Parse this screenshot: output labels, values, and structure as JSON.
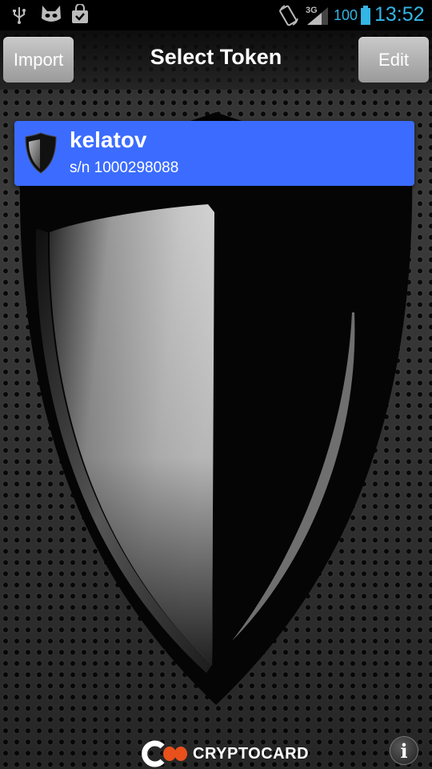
{
  "status_bar": {
    "battery_percent": "100",
    "network_type": "3G",
    "time": "13:52",
    "icons": [
      "usb-icon",
      "cyanogen-cat-icon",
      "shopping-bag-icon",
      "screen-rotation-icon",
      "signal-icon",
      "battery-icon"
    ],
    "accent_color": "#33b5e5"
  },
  "header": {
    "title": "Select Token",
    "import_label": "Import",
    "edit_label": "Edit"
  },
  "tokens": [
    {
      "name": "kelatov",
      "serial": "s/n 1000298088",
      "icon": "shield-icon"
    }
  ],
  "colors": {
    "token_highlight": "#3b6cff",
    "logo_orange": "#e8501c"
  },
  "footer": {
    "brand": "CRYPTOCARD",
    "info_glyph": "i"
  }
}
